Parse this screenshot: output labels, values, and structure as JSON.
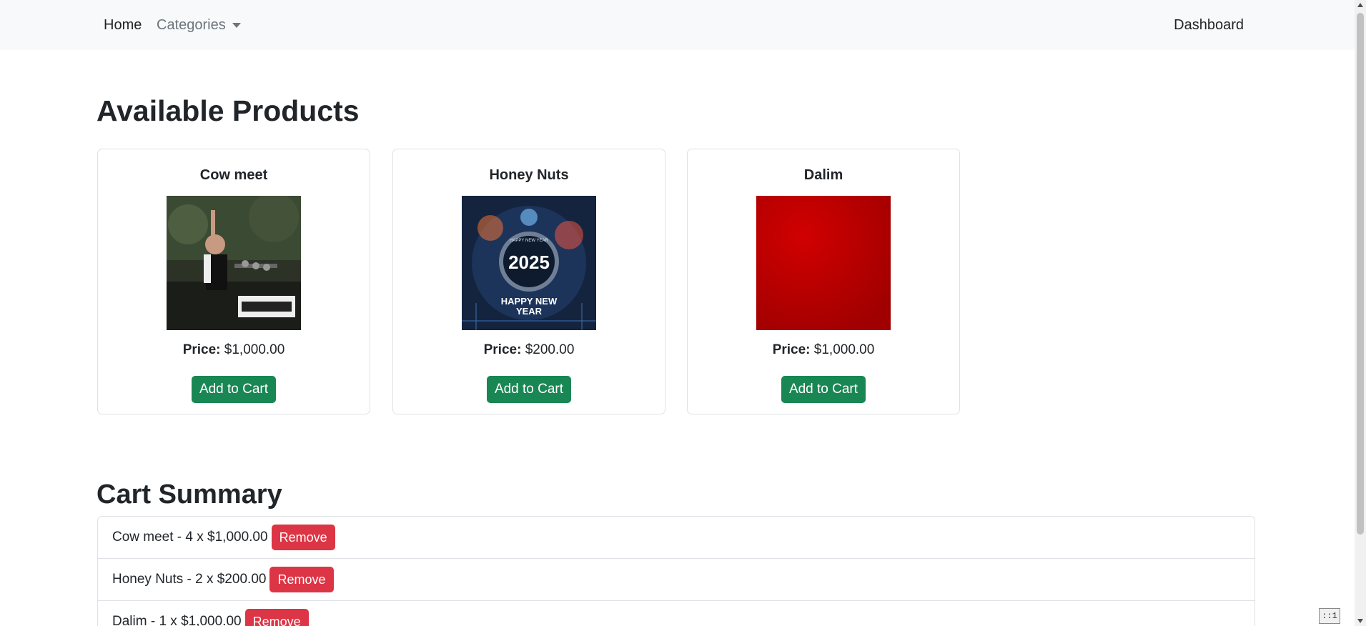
{
  "navbar": {
    "home_label": "Home",
    "categories_label": "Categories",
    "dashboard_label": "Dashboard"
  },
  "main": {
    "title": "Available Products",
    "products": [
      {
        "name": "Cow meet",
        "price_label": "Price:",
        "price": "$1,000.00",
        "button": "Add to Cart",
        "image": "photo-speaker-at-podium"
      },
      {
        "name": "Honey Nuts",
        "price_label": "Price:",
        "price": "$200.00",
        "button": "Add to Cart",
        "image": "happy-new-year-2025"
      },
      {
        "name": "Dalim",
        "price_label": "Price:",
        "price": "$1,000.00",
        "button": "Add to Cart",
        "image": "red-square"
      }
    ]
  },
  "cart": {
    "title": "Cart Summary",
    "items": [
      {
        "text": "Cow meet - 4 x $1,000.00",
        "button": "Remove"
      },
      {
        "text": "Honey Nuts - 2 x $200.00",
        "button": "Remove"
      },
      {
        "text": "Dalim - 1 x $1,000.00",
        "button": "Remove"
      }
    ]
  },
  "images": {
    "new_year_top": "HAPPY NEW YEAR",
    "new_year_number": "2025",
    "new_year_bottom_1": "HAPPY NEW",
    "new_year_bottom_2": "YEAR"
  },
  "corner_badge": "::1",
  "colors": {
    "navbar_bg": "#f8f9fa",
    "success": "#198754",
    "danger": "#dc3545",
    "border": "#dee2e6",
    "muted": "#6c757d"
  }
}
